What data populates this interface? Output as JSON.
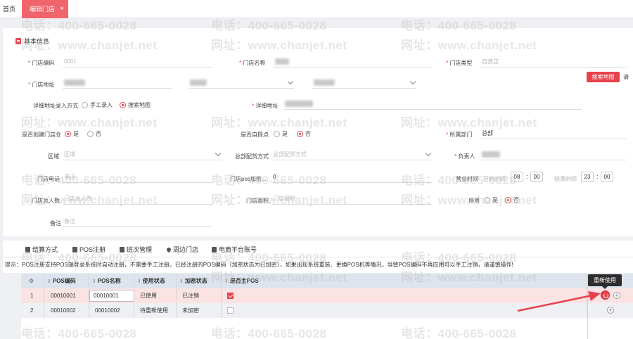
{
  "tabs": {
    "home": "首页",
    "active": "编辑门店",
    "close": "×"
  },
  "section_title": "基本信息",
  "fields": {
    "store_code_label": "门店编码",
    "store_code_value": "0001",
    "store_name_label": "门店名称",
    "store_type_label": "门店类型",
    "store_type_value": "自营店",
    "store_address_label": "门店地址",
    "address_mode_label": "详细地址录入方式",
    "address_mode_manual": "手工录入",
    "address_mode_map": "搜索地图",
    "detail_address_label": "详细地址",
    "search_map_button": "搜索地图",
    "map_tip": "请",
    "create_warehouse_label": "是否创建门店仓",
    "yes": "是",
    "no": "否",
    "self_pickup_label": "是否自提点",
    "department_label": "所属部门",
    "department_value": "总部",
    "region_label": "区域",
    "region_placeholder": "区域",
    "delivery_label": "总部配货方式",
    "delivery_placeholder": "总部配货方式",
    "manager_label": "负责人",
    "phone_label": "门店电话",
    "phone_placeholder": "电话",
    "pos_encrypt_label": "门店pos加密...",
    "pos_encrypt_value": "0",
    "hours_label": "营业时间",
    "start_label": "开始时间",
    "end_label": "结束时间",
    "start_h": "08",
    "start_m": "00",
    "end_h": "23",
    "end_m": "00",
    "headcount_label": "门店总人数",
    "headcount_placeholder": "门店总人数",
    "area_label": "门店面积",
    "area_placeholder": "门店面积",
    "disable_label": "停用",
    "remark_label": "备注",
    "remark_placeholder": "备注"
  },
  "subtabs": [
    "结算方式",
    "POS注册",
    "班次管理",
    "周边门店",
    "电商平台账号"
  ],
  "tip_text": "提示：POS注册支持POS端登录系统时自动注册，不需要手工注册。已经注册的POS编码（加密状态为已加密），如果出现系统重装、更换POS机等情况，导致POS编码不再应用可以手工注销，请谨慎操作!",
  "table": {
    "headers": [
      "POS编码",
      "POS名称",
      "使用状态",
      "加密状态",
      "是否主POS"
    ],
    "rows": [
      {
        "idx": "1",
        "code": "00010001",
        "name": "00010001",
        "status": "已使用",
        "encrypt": "已注销"
      },
      {
        "idx": "2",
        "code": "00010002",
        "name": "00010002",
        "status": "待重新使用",
        "encrypt": "未加密"
      }
    ],
    "tooltip": "重新使用"
  },
  "watermark": {
    "phone": "电话：400-665-0028",
    "site": "网址：www.chanjet.net"
  },
  "colors": {
    "accent": "#e8414b",
    "tab_active": "#f0646b",
    "header_row": "#dde4ee"
  },
  "icons": [
    "gear-icon",
    "plus-icon",
    "restore-icon",
    "chevron-down-icon",
    "pin-icon"
  ]
}
